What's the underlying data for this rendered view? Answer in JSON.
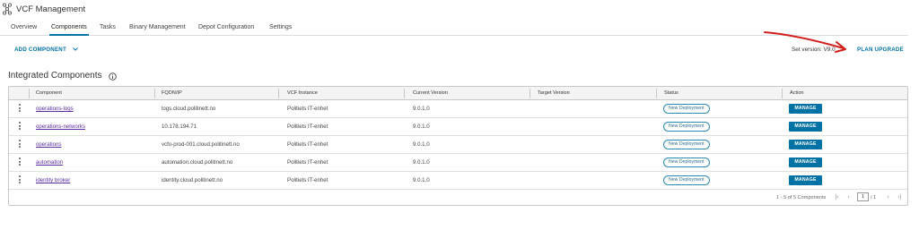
{
  "app": {
    "title": "VCF Management"
  },
  "tabs": [
    {
      "label": "Overview"
    },
    {
      "label": "Components",
      "active": true
    },
    {
      "label": "Tasks"
    },
    {
      "label": "Binary Management"
    },
    {
      "label": "Depot Configuration"
    },
    {
      "label": "Settings"
    }
  ],
  "toolbar": {
    "add_component_label": "ADD COMPONENT",
    "set_version_text": "Set version: V",
    "set_version_value": "9.0",
    "plan_upgrade_label": "PLAN UPGRADE"
  },
  "section": {
    "title": "Integrated Components"
  },
  "table": {
    "headers": [
      "Component",
      "FQDN/IP",
      "VCF Instance",
      "Current Version",
      "Target Version",
      "Status",
      "Action"
    ],
    "rows": [
      {
        "component": "operations-logs",
        "fqdn": "logs.cloud.politinett.no",
        "instance": "Politiets IT-enhet",
        "current": "9.0.1.0",
        "target": "",
        "status": "New Deployment",
        "action": "MANAGE"
      },
      {
        "component": "operations-networks",
        "fqdn": "10.178.194.71",
        "instance": "Politiets IT-enhet",
        "current": "9.0.1.0",
        "target": "",
        "status": "New Deployment",
        "action": "MANAGE"
      },
      {
        "component": "operations",
        "fqdn": "vcfo-prod-001.cloud.politinett.no",
        "instance": "Politiets IT-enhet",
        "current": "9.0.1.0",
        "target": "",
        "status": "New Deployment",
        "action": "MANAGE"
      },
      {
        "component": "automation",
        "fqdn": "automation.cloud.politinett.no",
        "instance": "Politiets IT-enhet",
        "current": "9.0.1.0",
        "target": "",
        "status": "New Deployment",
        "action": "MANAGE"
      },
      {
        "component": "identity broker",
        "fqdn": "identity.cloud.politinett.no",
        "instance": "Politiets IT-enhet",
        "current": "9.0.1.0",
        "target": "",
        "status": "New Deployment",
        "action": "MANAGE"
      }
    ]
  },
  "pagination": {
    "summary": "1 - 5 of 5 Components",
    "page": "1",
    "of_pages": "/ 1"
  },
  "colors": {
    "accent": "#0072a3",
    "link": "#5a2ca0",
    "annotation_arrow": "#d0201c"
  },
  "icons": {
    "app": "vcf-network-icon",
    "info": "info-circle-icon",
    "row_menu": "kebab-vertical-icon",
    "first": "first-page-icon",
    "prev": "prev-page-icon",
    "next": "next-page-icon",
    "last": "last-page-icon"
  }
}
